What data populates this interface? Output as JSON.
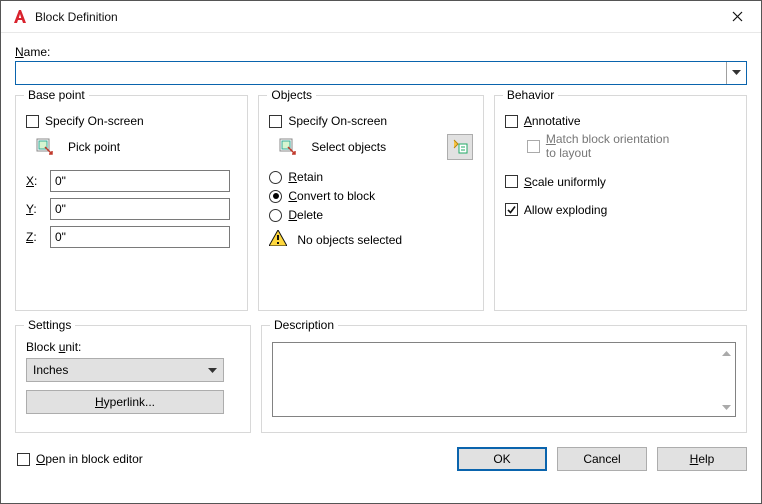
{
  "window": {
    "title": "Block Definition"
  },
  "name": {
    "label": "Name:",
    "label_u": "N",
    "value": ""
  },
  "basepoint": {
    "legend": "Base point",
    "specify_label": "Specify On-screen",
    "specify_u": "",
    "pick_label": "Pick point",
    "pick_u": "",
    "x_label": "X:",
    "x_u": "X",
    "x_val": "0\"",
    "y_label": "Y:",
    "y_u": "Y",
    "y_val": "0\"",
    "z_label": "Z:",
    "z_u": "Z",
    "z_val": "0\""
  },
  "objects": {
    "legend": "Objects",
    "specify_label": "Specify On-screen",
    "select_label": "Select objects",
    "retain": "Retain",
    "retain_u": "R",
    "convert": "Convert to block",
    "convert_u": "C",
    "delete": "Delete",
    "delete_u": "D",
    "status": "No objects selected"
  },
  "behavior": {
    "legend": "Behavior",
    "annotative": "Annotative",
    "annotative_u": "A",
    "match1": "Match block orientation",
    "match2": "to layout",
    "match_u": "M",
    "scale": "Scale uniformly",
    "scale_u": "S",
    "explode": "Allow exploding",
    "explode_u": ""
  },
  "settings": {
    "legend": "Settings",
    "unit_label": "Block unit:",
    "unit_u": "u",
    "unit_value": "Inches",
    "hyperlink": "Hyperlink...",
    "hyperlink_u": "H"
  },
  "description": {
    "legend": "Description",
    "value": ""
  },
  "footer": {
    "open_label": "Open in block editor",
    "open_u": "O",
    "ok": "OK",
    "cancel": "Cancel",
    "help": "Help",
    "help_u": "H"
  }
}
